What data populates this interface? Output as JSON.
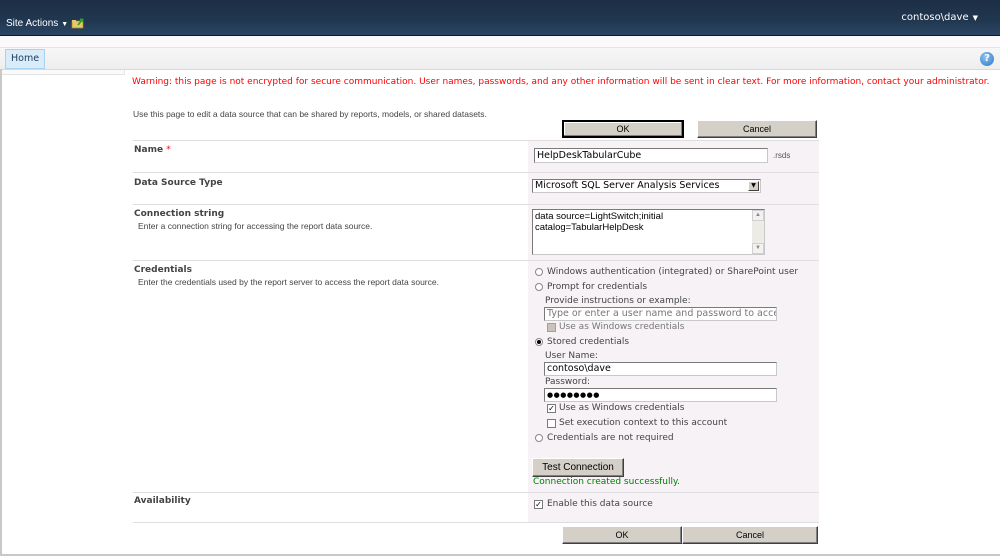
{
  "topbar": {
    "site_actions": "Site Actions",
    "user": "contoso\\dave",
    "navigate_up_icon": "folder-up-icon"
  },
  "tabs": {
    "home": "Home"
  },
  "help": {
    "glyph": "?"
  },
  "warning": "Warning: this page is not encrypted for secure communication. User names, passwords, and any other information will be sent in clear text. For more information, contact your administrator.",
  "intro": "Use this page to edit a data source that can be shared by reports, models, or shared datasets.",
  "buttons": {
    "ok": "OK",
    "cancel": "Cancel",
    "test_connection": "Test Connection"
  },
  "name": {
    "label": "Name",
    "required_marker": "*",
    "value": "HelpDeskTabularCube",
    "suffix": ".rsds"
  },
  "data_source_type": {
    "label": "Data Source Type",
    "selected": "Microsoft SQL Server Analysis Services"
  },
  "connection_string": {
    "label": "Connection string",
    "description": "Enter a connection string for accessing the report data source.",
    "lines": [
      "data source=LightSwitch;initial",
      "catalog=TabularHelpDesk"
    ]
  },
  "credentials": {
    "label": "Credentials",
    "description": "Enter the credentials used by the report server to access the report data source.",
    "options": {
      "windows": "Windows authentication (integrated) or SharePoint user",
      "prompt": "Prompt for credentials",
      "stored": "Stored credentials",
      "none": "Credentials are not required"
    },
    "selected": "stored",
    "prompt_instructions_label": "Provide instructions or example:",
    "prompt_instructions_placeholder": "Type or enter a user name and password to access",
    "prompt_use_windows": "Use as Windows credentials",
    "username_label": "User Name:",
    "username_value": "contoso\\dave",
    "password_label": "Password:",
    "password_value": "●●●●●●●●",
    "stored_use_windows": "Use as Windows credentials",
    "stored_use_windows_checked": true,
    "execution_context": "Set execution context to this account",
    "execution_context_checked": false,
    "test_result": "Connection created successfully."
  },
  "availability": {
    "label": "Availability",
    "enable_label": "Enable this data source",
    "enabled": true
  },
  "colors": {
    "header": "#213750",
    "warning": "#ff0000",
    "success": "#008000",
    "input_panel": "#f6f2f6"
  }
}
